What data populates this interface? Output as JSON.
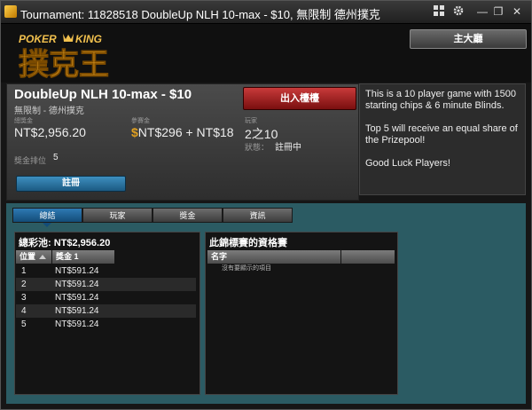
{
  "window": {
    "title": "Tournament: 11828518 DoubleUp NLH 10-max - $10, 無限制 德州撲克",
    "controls": {
      "grid_icon": "grid-icon",
      "settings_icon": "gear-icon",
      "minimize": "—",
      "restore": "❐",
      "close": "✕"
    }
  },
  "header": {
    "logo_top": "POKER KING",
    "logo_main": "撲克王",
    "lobby_label": "主大廳"
  },
  "tournament": {
    "name": "DoubleUp NLH 10-max - $10",
    "subtitle": "無限制 - 德州撲克",
    "register_top_label": "出入檯檯",
    "prizepool_label": "總獎金",
    "prizepool_value": "NT$2,956.20",
    "buyin_label": "參賽金",
    "buyin_value": "NT$296 + NT$18",
    "players_label": "玩家",
    "players_value": "2之10",
    "status_label": "狀態：",
    "status_value": "註冊中",
    "prize_rank_label": "獎金排位",
    "prize_rank_value": "5",
    "register_label": "註冊"
  },
  "description": {
    "p1": "This is a 10 player game with 1500 starting chips & 6 minute Blinds.",
    "p2": "Top 5 will receive an equal share of the Prizepool!",
    "p3": "Good Luck Players!"
  },
  "tabs": [
    {
      "label": "總結"
    },
    {
      "label": "玩家"
    },
    {
      "label": "獎金"
    },
    {
      "label": "資訊"
    }
  ],
  "summary": {
    "pool_label": "總彩池: NT$2,956.20",
    "col_position": "位置",
    "col_prize": "獎金 1",
    "rows": [
      {
        "pos": "1",
        "prize": "NT$591.24"
      },
      {
        "pos": "2",
        "prize": "NT$591.24"
      },
      {
        "pos": "3",
        "prize": "NT$591.24"
      },
      {
        "pos": "4",
        "prize": "NT$591.24"
      },
      {
        "pos": "5",
        "prize": "NT$591.24"
      }
    ]
  },
  "qualifiers": {
    "title": "此錦標賽的資格賽",
    "col_name": "名字",
    "empty_message": "沒有要顯示的項目"
  }
}
